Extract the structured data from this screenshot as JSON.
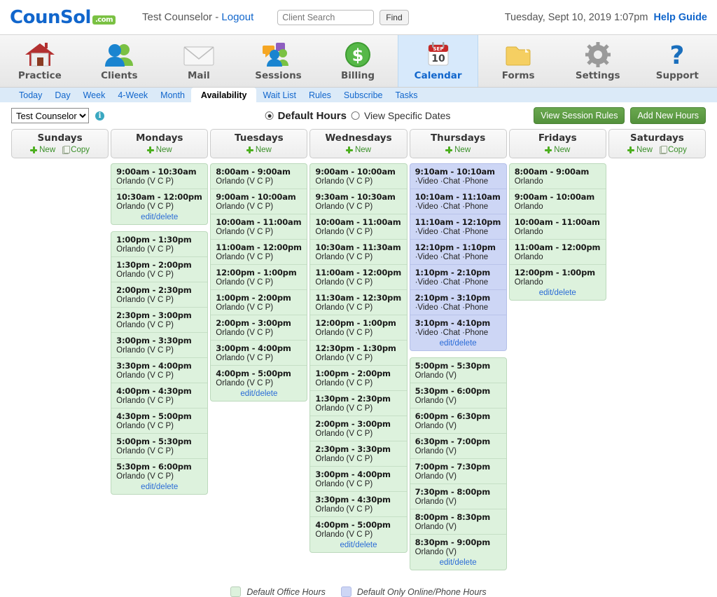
{
  "brand": {
    "name": "CounSol",
    "suffix": ".com",
    "accent": "#1166cc",
    "green": "#7ac143"
  },
  "header": {
    "user": "Test Counselor - ",
    "logout": "Logout",
    "search_placeholder": "Client Search",
    "search_value": "",
    "find_label": "Find",
    "datetime": "Tuesday, Sept 10, 2019  1:07pm",
    "help_label": "Help Guide"
  },
  "mainnav": [
    {
      "label": "Practice",
      "icon": "house-icon",
      "active": false
    },
    {
      "label": "Clients",
      "icon": "people-icon",
      "active": false
    },
    {
      "label": "Mail",
      "icon": "envelope-icon",
      "active": false
    },
    {
      "label": "Sessions",
      "icon": "chat-people-icon",
      "active": false
    },
    {
      "label": "Billing",
      "icon": "dollar-icon",
      "active": false
    },
    {
      "label": "Calendar",
      "icon": "calendar-icon",
      "active": true
    },
    {
      "label": "Forms",
      "icon": "folder-icon",
      "active": false
    },
    {
      "label": "Settings",
      "icon": "gear-icon",
      "active": false
    },
    {
      "label": "Support",
      "icon": "question-icon",
      "active": false
    }
  ],
  "calendar_icon": {
    "month": "SEP",
    "day": "10"
  },
  "subnav": [
    {
      "label": "Today",
      "active": false
    },
    {
      "label": "Day",
      "active": false
    },
    {
      "label": "Week",
      "active": false
    },
    {
      "label": "4-Week",
      "active": false
    },
    {
      "label": "Month",
      "active": false
    },
    {
      "label": "Availability",
      "active": true
    },
    {
      "label": "Wait List",
      "active": false
    },
    {
      "label": "Rules",
      "active": false
    },
    {
      "label": "Subscribe",
      "active": false
    },
    {
      "label": "Tasks",
      "active": false
    }
  ],
  "controls": {
    "counselor_selected": "Test Counselor",
    "counselor_options": [
      "Test Counselor"
    ],
    "info_glyph": "i",
    "radio_default_hours": "Default Hours",
    "radio_specific_dates": "View Specific Dates",
    "radio_selected": "Default Hours",
    "view_session_rules": "View Session Rules",
    "add_new_hours": "Add New Hours"
  },
  "day_actions": {
    "new": "New",
    "copy": "Copy"
  },
  "edit_delete_label": "edit/delete",
  "legend": [
    {
      "type": "office",
      "label": "Default Office Hours",
      "color": "#ddf2dd"
    },
    {
      "type": "online",
      "label": "Default Only Online/Phone Hours",
      "color": "#cdd6f5"
    }
  ],
  "days": [
    {
      "title": "Sundays",
      "has_copy": true,
      "blocks": []
    },
    {
      "title": "Mondays",
      "has_copy": false,
      "blocks": [
        {
          "type": "office",
          "slots": [
            {
              "time": "9:00am - 10:30am",
              "loc": "Orlando (V C P)"
            },
            {
              "time": "10:30am - 12:00pm",
              "loc": "Orlando (V C P)"
            }
          ]
        },
        {
          "type": "office",
          "slots": [
            {
              "time": "1:00pm - 1:30pm",
              "loc": "Orlando (V C P)"
            },
            {
              "time": "1:30pm - 2:00pm",
              "loc": "Orlando (V C P)"
            },
            {
              "time": "2:00pm - 2:30pm",
              "loc": "Orlando (V C P)"
            },
            {
              "time": "2:30pm - 3:00pm",
              "loc": "Orlando (V C P)"
            },
            {
              "time": "3:00pm - 3:30pm",
              "loc": "Orlando (V C P)"
            },
            {
              "time": "3:30pm - 4:00pm",
              "loc": "Orlando (V C P)"
            },
            {
              "time": "4:00pm - 4:30pm",
              "loc": "Orlando (V C P)"
            },
            {
              "time": "4:30pm - 5:00pm",
              "loc": "Orlando (V C P)"
            },
            {
              "time": "5:00pm - 5:30pm",
              "loc": "Orlando (V C P)"
            },
            {
              "time": "5:30pm - 6:00pm",
              "loc": "Orlando (V C P)"
            }
          ]
        }
      ]
    },
    {
      "title": "Tuesdays",
      "has_copy": false,
      "blocks": [
        {
          "type": "office",
          "slots": [
            {
              "time": "8:00am - 9:00am",
              "loc": "Orlando (V C P)"
            },
            {
              "time": "9:00am - 10:00am",
              "loc": "Orlando (V C P)"
            },
            {
              "time": "10:00am - 11:00am",
              "loc": "Orlando (V C P)"
            },
            {
              "time": "11:00am - 12:00pm",
              "loc": "Orlando (V C P)"
            },
            {
              "time": "12:00pm - 1:00pm",
              "loc": "Orlando (V C P)"
            },
            {
              "time": "1:00pm - 2:00pm",
              "loc": "Orlando (V C P)"
            },
            {
              "time": "2:00pm - 3:00pm",
              "loc": "Orlando (V C P)"
            },
            {
              "time": "3:00pm - 4:00pm",
              "loc": "Orlando (V C P)"
            },
            {
              "time": "4:00pm - 5:00pm",
              "loc": "Orlando (V C P)"
            }
          ]
        }
      ]
    },
    {
      "title": "Wednesdays",
      "has_copy": false,
      "blocks": [
        {
          "type": "office",
          "slots": [
            {
              "time": "9:00am - 10:00am",
              "loc": "Orlando (V C P)"
            },
            {
              "time": "9:30am - 10:30am",
              "loc": "Orlando (V C P)"
            },
            {
              "time": "10:00am - 11:00am",
              "loc": "Orlando (V C P)"
            },
            {
              "time": "10:30am - 11:30am",
              "loc": "Orlando (V C P)"
            },
            {
              "time": "11:00am - 12:00pm",
              "loc": "Orlando (V C P)"
            },
            {
              "time": "11:30am - 12:30pm",
              "loc": "Orlando (V C P)"
            },
            {
              "time": "12:00pm - 1:00pm",
              "loc": "Orlando (V C P)"
            },
            {
              "time": "12:30pm - 1:30pm",
              "loc": "Orlando (V C P)"
            },
            {
              "time": "1:00pm - 2:00pm",
              "loc": "Orlando (V C P)"
            },
            {
              "time": "1:30pm - 2:30pm",
              "loc": "Orlando (V C P)"
            },
            {
              "time": "2:00pm - 3:00pm",
              "loc": "Orlando (V C P)"
            },
            {
              "time": "2:30pm - 3:30pm",
              "loc": "Orlando (V C P)"
            },
            {
              "time": "3:00pm - 4:00pm",
              "loc": "Orlando (V C P)"
            },
            {
              "time": "3:30pm - 4:30pm",
              "loc": "Orlando (V C P)"
            },
            {
              "time": "4:00pm - 5:00pm",
              "loc": "Orlando (V C P)"
            }
          ]
        }
      ]
    },
    {
      "title": "Thursdays",
      "has_copy": false,
      "blocks": [
        {
          "type": "online",
          "slots": [
            {
              "time": "9:10am - 10:10am",
              "loc": "·Video ·Chat ·Phone"
            },
            {
              "time": "10:10am - 11:10am",
              "loc": "·Video ·Chat ·Phone"
            },
            {
              "time": "11:10am - 12:10pm",
              "loc": "·Video ·Chat ·Phone"
            },
            {
              "time": "12:10pm - 1:10pm",
              "loc": "·Video ·Chat ·Phone"
            },
            {
              "time": "1:10pm - 2:10pm",
              "loc": "·Video ·Chat ·Phone"
            },
            {
              "time": "2:10pm - 3:10pm",
              "loc": "·Video ·Chat ·Phone"
            },
            {
              "time": "3:10pm - 4:10pm",
              "loc": "·Video ·Chat ·Phone"
            }
          ]
        },
        {
          "type": "office",
          "slots": [
            {
              "time": "5:00pm - 5:30pm",
              "loc": "Orlando (V)"
            },
            {
              "time": "5:30pm - 6:00pm",
              "loc": "Orlando (V)"
            },
            {
              "time": "6:00pm - 6:30pm",
              "loc": "Orlando (V)"
            },
            {
              "time": "6:30pm - 7:00pm",
              "loc": "Orlando (V)"
            },
            {
              "time": "7:00pm - 7:30pm",
              "loc": "Orlando (V)"
            },
            {
              "time": "7:30pm - 8:00pm",
              "loc": "Orlando (V)"
            },
            {
              "time": "8:00pm - 8:30pm",
              "loc": "Orlando (V)"
            },
            {
              "time": "8:30pm - 9:00pm",
              "loc": "Orlando (V)"
            }
          ]
        }
      ]
    },
    {
      "title": "Fridays",
      "has_copy": false,
      "blocks": [
        {
          "type": "office",
          "slots": [
            {
              "time": "8:00am - 9:00am",
              "loc": "Orlando"
            },
            {
              "time": "9:00am - 10:00am",
              "loc": "Orlando"
            },
            {
              "time": "10:00am - 11:00am",
              "loc": "Orlando"
            },
            {
              "time": "11:00am - 12:00pm",
              "loc": "Orlando"
            },
            {
              "time": "12:00pm - 1:00pm",
              "loc": "Orlando"
            }
          ]
        }
      ]
    },
    {
      "title": "Saturdays",
      "has_copy": true,
      "blocks": []
    }
  ]
}
